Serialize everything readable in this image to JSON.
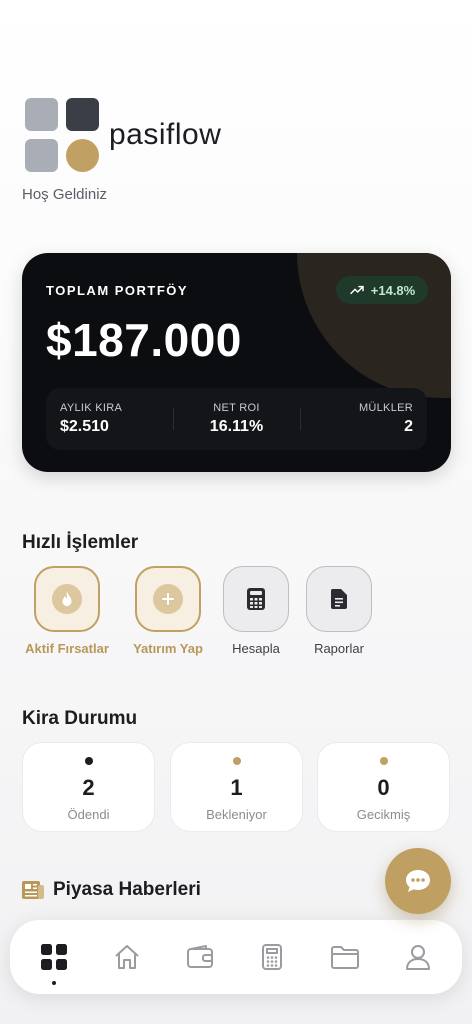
{
  "app": {
    "name": "pasiflow",
    "welcome": "Hoş Geldiniz"
  },
  "portfolio": {
    "label": "TOPLAM PORTFÖY",
    "change": "+14.8%",
    "total": "$187.000",
    "stats": [
      {
        "label": "AYLIK KIRA",
        "value": "$2.510"
      },
      {
        "label": "NET ROI",
        "value": "16.11%"
      },
      {
        "label": "MÜLKLER",
        "value": "2"
      }
    ]
  },
  "quick_actions": {
    "title": "Hızlı İşlemler",
    "items": [
      {
        "label": "Aktif Fırsatlar",
        "icon": "flame-icon",
        "style": "gold"
      },
      {
        "label": "Yatırım Yap",
        "icon": "plus-circle-icon",
        "style": "gold"
      },
      {
        "label": "Hesapla",
        "icon": "calculator-icon",
        "style": "gray"
      },
      {
        "label": "Raporlar",
        "icon": "document-icon",
        "style": "gray"
      }
    ]
  },
  "rent_status": {
    "title": "Kira Durumu",
    "items": [
      {
        "count": "2",
        "label": "Ödendi",
        "dot_color": "#1c1d21"
      },
      {
        "count": "1",
        "label": "Bekleniyor",
        "dot_color": "#c1a064"
      },
      {
        "count": "0",
        "label": "Gecikmiş",
        "dot_color": "#c1a064"
      }
    ]
  },
  "news": {
    "title": "Piyasa Haberleri",
    "icon": "newspaper-icon"
  },
  "nav": {
    "items": [
      {
        "icon": "dashboard-grid-icon",
        "active": true
      },
      {
        "icon": "home-icon",
        "active": false
      },
      {
        "icon": "wallet-icon",
        "active": false
      },
      {
        "icon": "calculator-icon",
        "active": false
      },
      {
        "icon": "folder-icon",
        "active": false
      },
      {
        "icon": "user-icon",
        "active": false
      }
    ]
  },
  "colors": {
    "accent": "#c1a064",
    "dark": "#0c0d10",
    "positive": "#bfe8cf"
  }
}
